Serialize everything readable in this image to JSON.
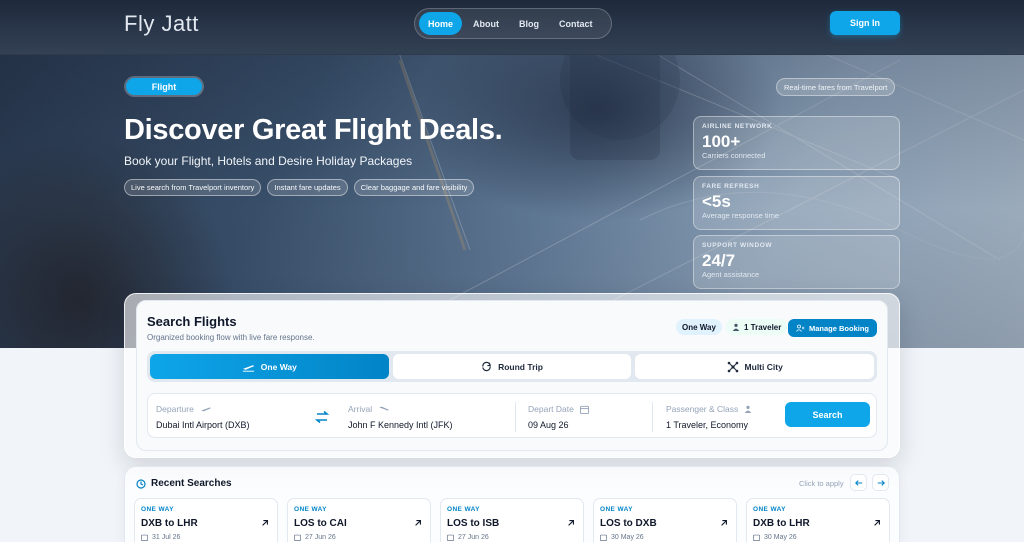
{
  "nav": {
    "brand": "Fly Jatt",
    "items": [
      {
        "label": "Home",
        "active": true
      },
      {
        "label": "About",
        "active": false
      },
      {
        "label": "Blog",
        "active": false
      },
      {
        "label": "Contact",
        "active": false
      }
    ],
    "signin_label": "Sign In"
  },
  "hero": {
    "chip": "Flight",
    "realtime": "Real-time fares from Travelport",
    "title": "Discover Great Flight Deals.",
    "subtitle": "Book your Flight, Hotels and Desire Holiday Packages",
    "features": [
      "Live search from Travelport inventory",
      "Instant fare updates",
      "Clear baggage and fare visibility"
    ],
    "stats": [
      {
        "label": "AIRLINE NETWORK",
        "value": "100+",
        "desc": "Carriers connected"
      },
      {
        "label": "FARE REFRESH",
        "value": "<5s",
        "desc": "Average response time"
      },
      {
        "label": "SUPPORT WINDOW",
        "value": "24/7",
        "desc": "Agent assistance"
      }
    ]
  },
  "search": {
    "title": "Search Flights",
    "subtitle": "Organized booking flow with live fare response.",
    "pill_trip": "One Way",
    "pill_traveler": "1 Traveler",
    "manage_label": "Manage Booking",
    "tabs": [
      {
        "label": "One Way",
        "active": true
      },
      {
        "label": "Round Trip",
        "active": false
      },
      {
        "label": "Multi City",
        "active": false
      }
    ],
    "departure_label": "Departure",
    "departure_value": "Dubai Intl Airport (DXB)",
    "arrival_label": "Arrival",
    "arrival_value": "John F Kennedy Intl (JFK)",
    "date_label": "Depart Date",
    "date_value": "09 Aug 26",
    "pax_label": "Passenger & Class",
    "pax_value": "1 Traveler, Economy",
    "button": "Search"
  },
  "recent": {
    "title": "Recent Searches",
    "hint": "Click to apply",
    "items": [
      {
        "type": "ONE WAY",
        "route": "DXB to LHR",
        "date": "31 Jul 26"
      },
      {
        "type": "ONE WAY",
        "route": "LOS to CAI",
        "date": "27 Jun 26"
      },
      {
        "type": "ONE WAY",
        "route": "LOS to ISB",
        "date": "27 Jun 26"
      },
      {
        "type": "ONE WAY",
        "route": "LOS to DXB",
        "date": "30 May 26"
      },
      {
        "type": "ONE WAY",
        "route": "DXB to LHR",
        "date": "30 May 26"
      }
    ]
  },
  "colors": {
    "accent": "#0ea5e9",
    "accent_dark": "#0284c7",
    "navbar": "#1e293b"
  }
}
